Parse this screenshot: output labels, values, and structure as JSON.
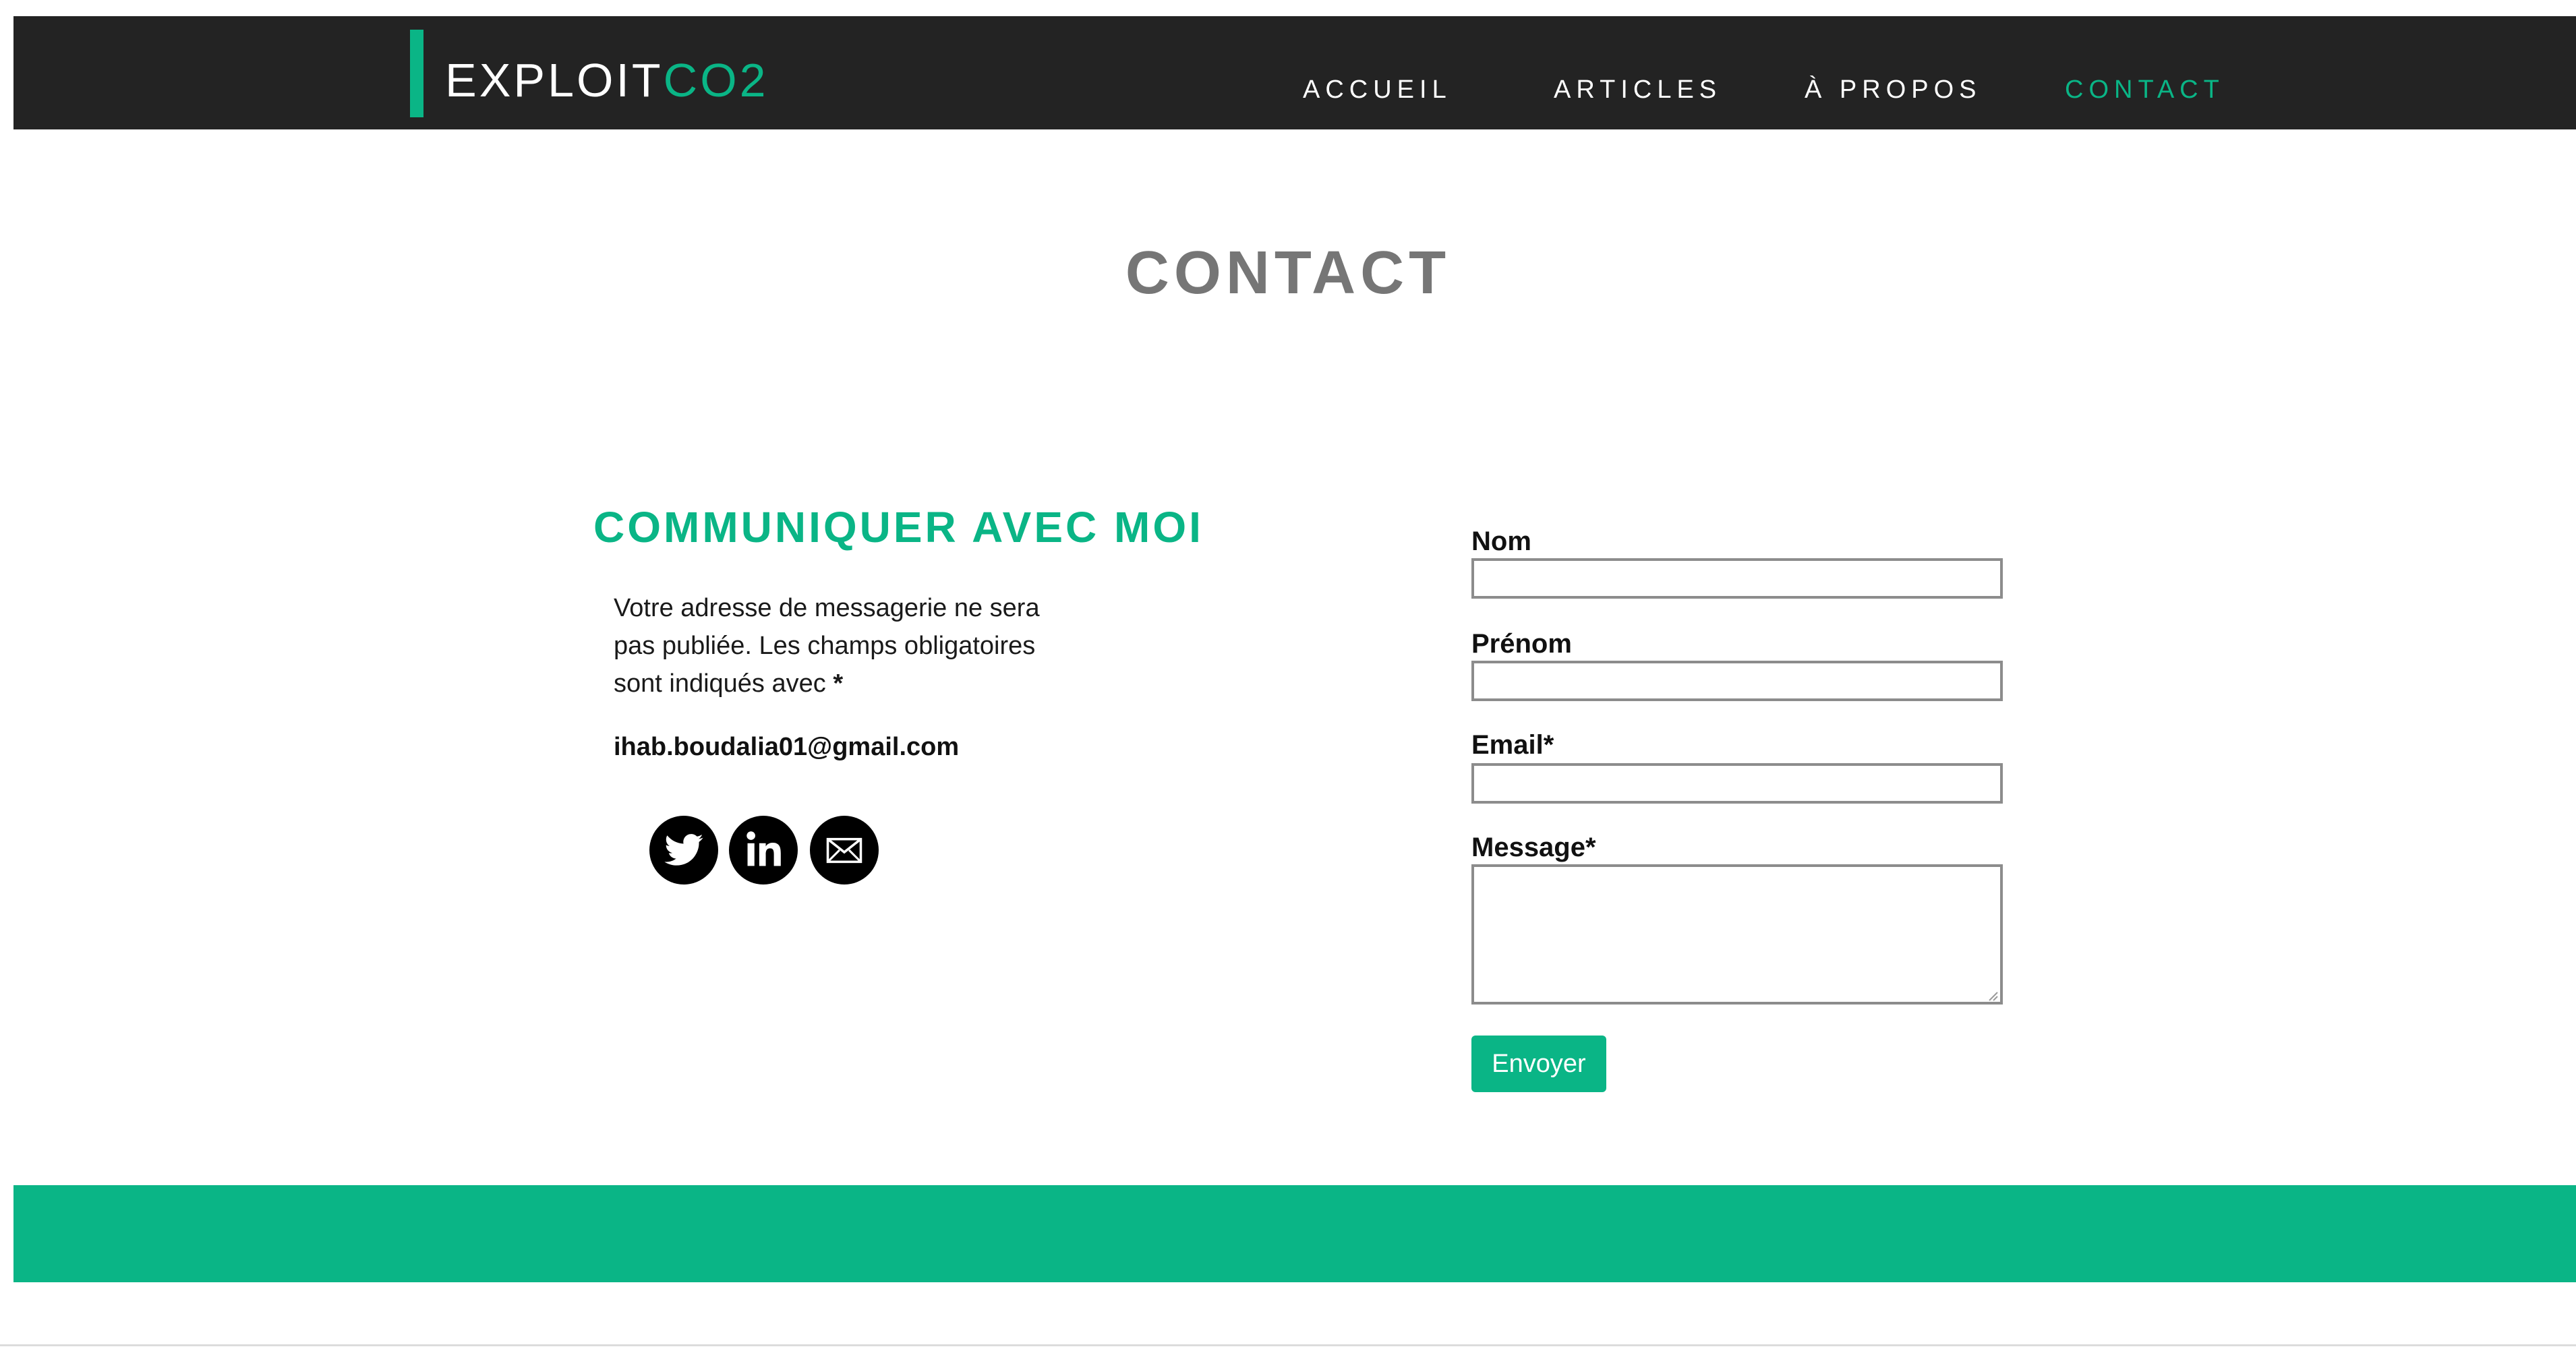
{
  "site": {
    "logo_main": "EXPLOIT",
    "logo_accent": "CO2",
    "accent_color": "#0ab586",
    "header_color": "#232323"
  },
  "nav": {
    "items": [
      {
        "label": "ACCUEIL",
        "active": false
      },
      {
        "label": "ARTICLES",
        "active": false
      },
      {
        "label": "À PROPOS",
        "active": false
      },
      {
        "label": "CONTACT",
        "active": true
      }
    ]
  },
  "page": {
    "title": "CONTACT"
  },
  "info": {
    "heading": "COMMUNIQUER AVEC MOI",
    "text": "Votre adresse de messagerie ne sera pas publiée. Les champs obligatoires sont indiqués avec",
    "required_mark": "*",
    "email": "ihab.boudalia01@gmail.com",
    "social": [
      {
        "icon": "twitter-icon"
      },
      {
        "icon": "linkedin-icon"
      },
      {
        "icon": "mail-icon"
      }
    ]
  },
  "form": {
    "nom_label": "Nom",
    "nom_value": "",
    "prenom_label": "Prénom",
    "prenom_value": "",
    "email_label": "Email*",
    "email_value": "",
    "message_label": "Message*",
    "message_value": "",
    "submit_label": "Envoyer"
  }
}
